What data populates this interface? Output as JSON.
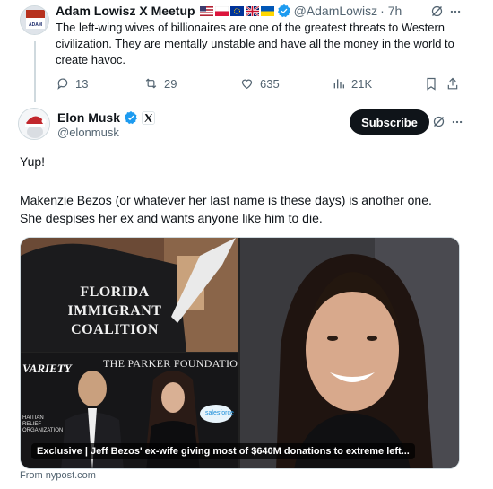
{
  "quoted_post": {
    "display_name": "Adam Lowisz X Meetup",
    "flags": [
      "us-flag-icon",
      "poland-flag-icon",
      "eu-flag-icon",
      "uk-flag-icon",
      "ukraine-flag-icon"
    ],
    "handle": "@AdamLowisz",
    "time": "· 7h",
    "text": "The left-wing wives of billionaires are one of the greatest threats to Western civilization. They are mentally unstable and have all the money in the world to create havoc.",
    "replies": "13",
    "reposts": "29",
    "likes": "635",
    "views": "21K"
  },
  "reply": {
    "display_name": "Elon Musk",
    "handle": "@elonmusk",
    "subscribe_label": "Subscribe",
    "text_line1": "Yup!",
    "text_line2": "Makenzie Bezos (or whatever her last name is these days) is another one. She despises her ex and wants anyone like him to die."
  },
  "media": {
    "shirt_text_1": "FLORIDA",
    "shirt_text_2": "IMMIGRANT",
    "shirt_text_3": "COALITION",
    "backdrop_left": "VARIETY",
    "backdrop_right": "THE PARKER FOUNDATION",
    "backdrop_small": "HAITIAN RELIEF ORGANIZATION",
    "backdrop_logo": "salesforce",
    "caption": "Exclusive | Jeff Bezos' ex-wife giving most of $640M donations to extreme left...",
    "source": "From nypost.com"
  },
  "colors": {
    "accent": "#1d9bf0",
    "dark_button": "#0f1419",
    "muted": "#536471"
  }
}
